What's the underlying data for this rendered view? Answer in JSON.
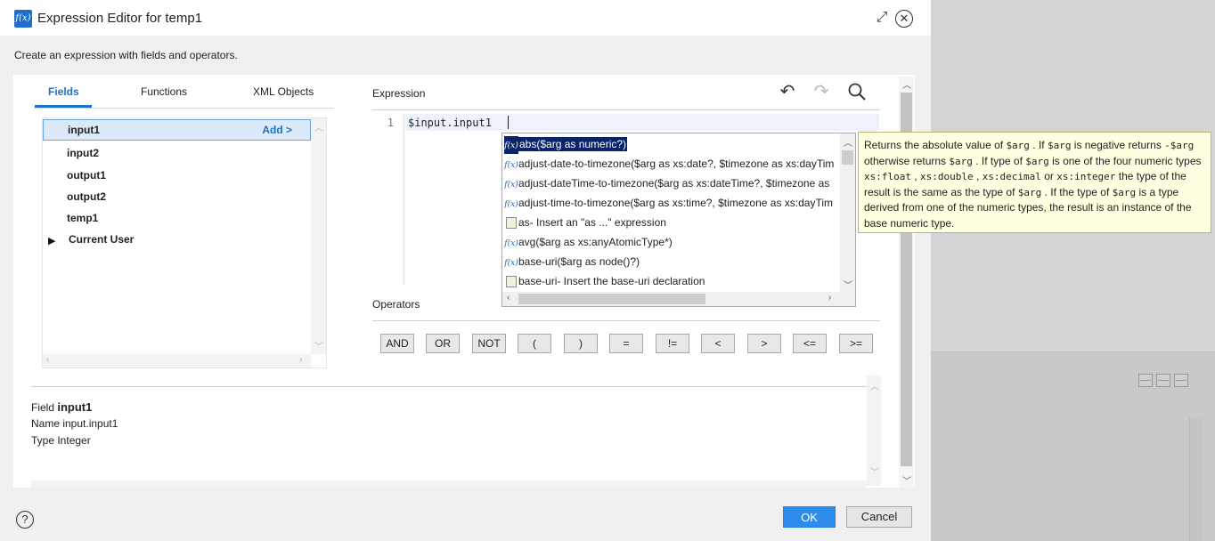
{
  "dialog": {
    "title": "Expression Editor for temp1",
    "subtitle": "Create an expression with fields and operators.",
    "icon": "fx-icon"
  },
  "tabs": [
    {
      "label": "Fields",
      "active": true
    },
    {
      "label": "Functions",
      "active": false
    },
    {
      "label": "XML Objects",
      "active": false
    }
  ],
  "fields": {
    "add_label": "Add >",
    "items": [
      {
        "label": "input1",
        "selected": true
      },
      {
        "label": "input2"
      },
      {
        "label": "output1"
      },
      {
        "label": "output2"
      },
      {
        "label": "temp1"
      },
      {
        "label": "Current User",
        "collapsed": true
      }
    ]
  },
  "details": {
    "field_key": "Field",
    "field_value": "input1",
    "name_line": "Name input.input1",
    "type_line": "Type Integer"
  },
  "expression": {
    "label": "Expression",
    "line_number": "1",
    "code": "$input.input1"
  },
  "autocomplete": {
    "items": [
      {
        "kind": "function",
        "text": "abs($arg as numeric?)",
        "selected": true
      },
      {
        "kind": "function",
        "text": "adjust-date-to-timezone($arg as xs:date?, $timezone as xs:dayTim"
      },
      {
        "kind": "function",
        "text": "adjust-dateTime-to-timezone($arg as xs:dateTime?, $timezone as"
      },
      {
        "kind": "function",
        "text": "adjust-time-to-timezone($arg as xs:time?, $timezone as xs:dayTim"
      },
      {
        "kind": "snippet",
        "text": "as- Insert an \"as ...\" expression"
      },
      {
        "kind": "function",
        "text": "avg($arg as xs:anyAtomicType*)"
      },
      {
        "kind": "function",
        "text": "base-uri($arg as node()?)"
      },
      {
        "kind": "snippet",
        "text": "base-uri- Insert the base-uri declaration"
      }
    ]
  },
  "tooltip": {
    "parts": [
      {
        "t": "Returns the absolute value of "
      },
      {
        "c": "$arg"
      },
      {
        "t": " . If "
      },
      {
        "c": "$arg"
      },
      {
        "t": " is negative returns "
      },
      {
        "c": "-$arg"
      },
      {
        "t": " otherwise returns "
      },
      {
        "c": "$arg"
      },
      {
        "t": " . If type of "
      },
      {
        "c": "$arg"
      },
      {
        "t": " is one of the four numeric types "
      },
      {
        "c": "xs:float"
      },
      {
        "t": " , "
      },
      {
        "c": "xs:double"
      },
      {
        "t": " , "
      },
      {
        "c": "xs:decimal"
      },
      {
        "t": " or "
      },
      {
        "c": "xs:integer"
      },
      {
        "t": " the type of the result is the same as the type of "
      },
      {
        "c": "$arg"
      },
      {
        "t": " . If the type of "
      },
      {
        "c": "$arg"
      },
      {
        "t": " is a type derived from one of the numeric types, the result is an instance of the base numeric type."
      }
    ]
  },
  "operators": {
    "label": "Operators",
    "items": [
      "AND",
      "OR",
      "NOT",
      "(",
      ")",
      "=",
      "!=",
      "<",
      ">",
      "<=",
      ">="
    ]
  },
  "footer": {
    "ok_label": "OK",
    "cancel_label": "Cancel"
  },
  "colors": {
    "accent": "#1a73c9",
    "primary_button": "#2d8ceb",
    "tooltip_bg": "#ffffe1",
    "selection": "#0a246a"
  }
}
